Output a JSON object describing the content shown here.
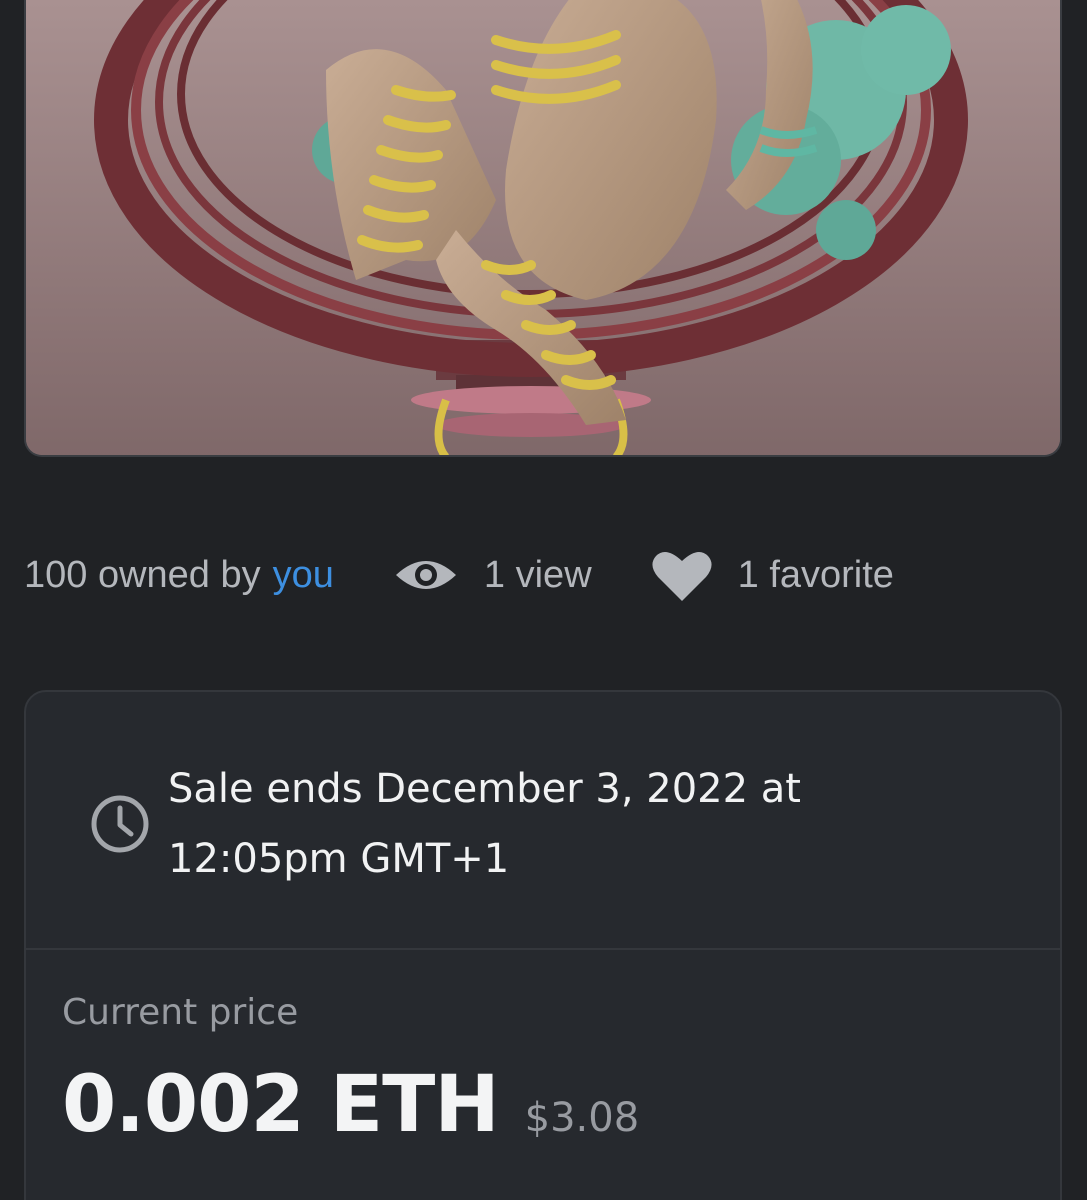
{
  "nft_image": {
    "alt_icon": "nft-artwork-image"
  },
  "stats": {
    "owned_prefix": "100 owned by",
    "owned_link": "you",
    "views": "1 view",
    "favorites": "1 favorite",
    "view_icon": "eye-icon",
    "favorite_icon": "heart-icon"
  },
  "sale": {
    "clock_icon": "clock-icon",
    "ends_line1": "Sale ends December 3, 2022 at",
    "ends_line2": "12:05pm GMT+1",
    "price_label": "Current price",
    "price_eth": "0.002 ETH",
    "price_usd": "$3.08"
  },
  "colors": {
    "background": "#202225",
    "link": "#3d8fe0",
    "panel": "#26292e"
  }
}
